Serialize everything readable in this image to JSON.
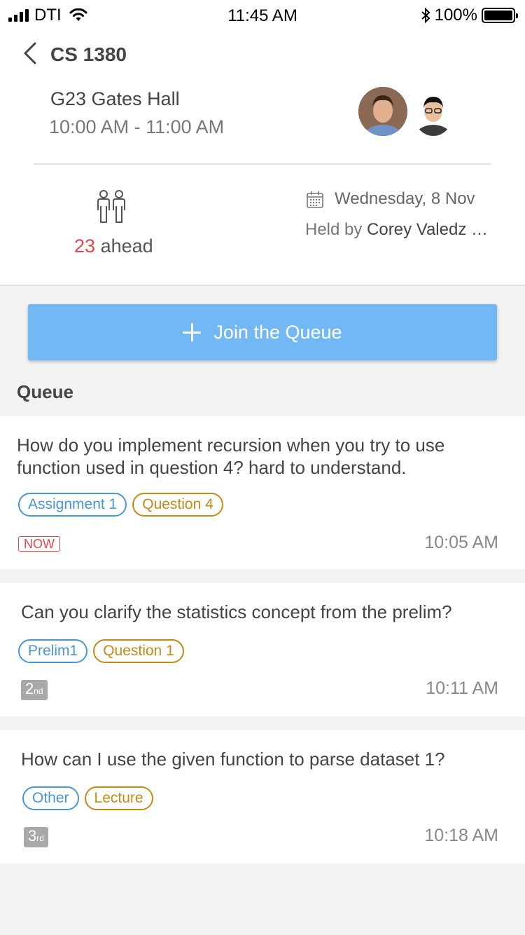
{
  "status_bar": {
    "carrier": "DTI",
    "time": "11:45 AM",
    "battery": "100%"
  },
  "header": {
    "course": "CS 1380",
    "location": "G23 Gates Hall",
    "time_range": "10:00 AM - 11:00 AM",
    "ahead_count": "23",
    "ahead_label": "ahead",
    "date": "Wednesday, 8 Nov",
    "held_by_label": "Held by",
    "host": "Corey Valedz …"
  },
  "join_button": {
    "label": "Join the Queue"
  },
  "queue": {
    "title": "Queue",
    "items": [
      {
        "question": " How do you implement recursion when you try to use function used in question 4? hard to  understand.",
        "tags": [
          "Assignment 1",
          "Question 4"
        ],
        "badge": "NOW",
        "time": "10:05 AM"
      },
      {
        "question": "Can you clarify the statistics concept from the prelim?",
        "tags": [
          "Prelim1",
          "Question 1"
        ],
        "badge_num": "2",
        "badge_suffix": "nd",
        "time": "10:11 AM"
      },
      {
        "question": "How can I use the given function to parse dataset 1?",
        "tags": [
          "Other",
          "Lecture"
        ],
        "badge_num": "3",
        "badge_suffix": "rd",
        "time": "10:18 AM"
      }
    ]
  },
  "colors": {
    "accent": "#72b8f5",
    "tag_blue": "#4a95d4",
    "tag_orange": "#c38a16",
    "now_red": "#e0474c"
  }
}
